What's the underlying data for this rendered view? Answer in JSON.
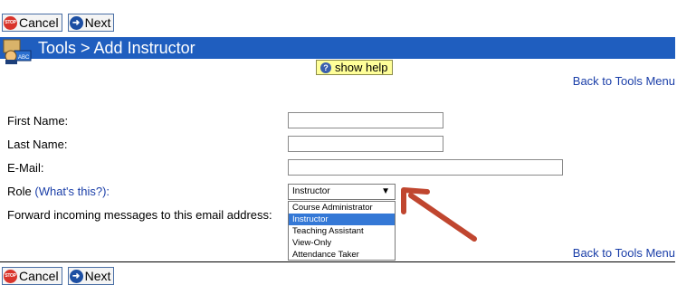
{
  "toolbar": {
    "cancel_label": "Cancel",
    "next_label": "Next",
    "stop_icon_text": "STOP"
  },
  "header": {
    "title": "Tools > Add Instructor"
  },
  "help": {
    "label": "show help"
  },
  "links": {
    "back_to_tools": "Back to Tools Menu"
  },
  "form": {
    "first_name_label": "First Name:",
    "last_name_label": "Last Name:",
    "email_label": "E-Mail:",
    "role_label": "Role",
    "role_help_link": "(What's this?):",
    "forward_label": "Forward incoming messages to this email address:",
    "first_name_value": "",
    "last_name_value": "",
    "email_value": "",
    "role_selected": "Instructor",
    "role_options": [
      "Course Administrator",
      "Instructor",
      "Teaching Assistant",
      "View-Only",
      "Attendance Taker"
    ]
  },
  "colors": {
    "title_bar": "#1f5ebf",
    "link": "#1a3ea8",
    "help_bg": "#ffff99",
    "arrow": "#c0462f",
    "selected_option": "#3478d6"
  }
}
